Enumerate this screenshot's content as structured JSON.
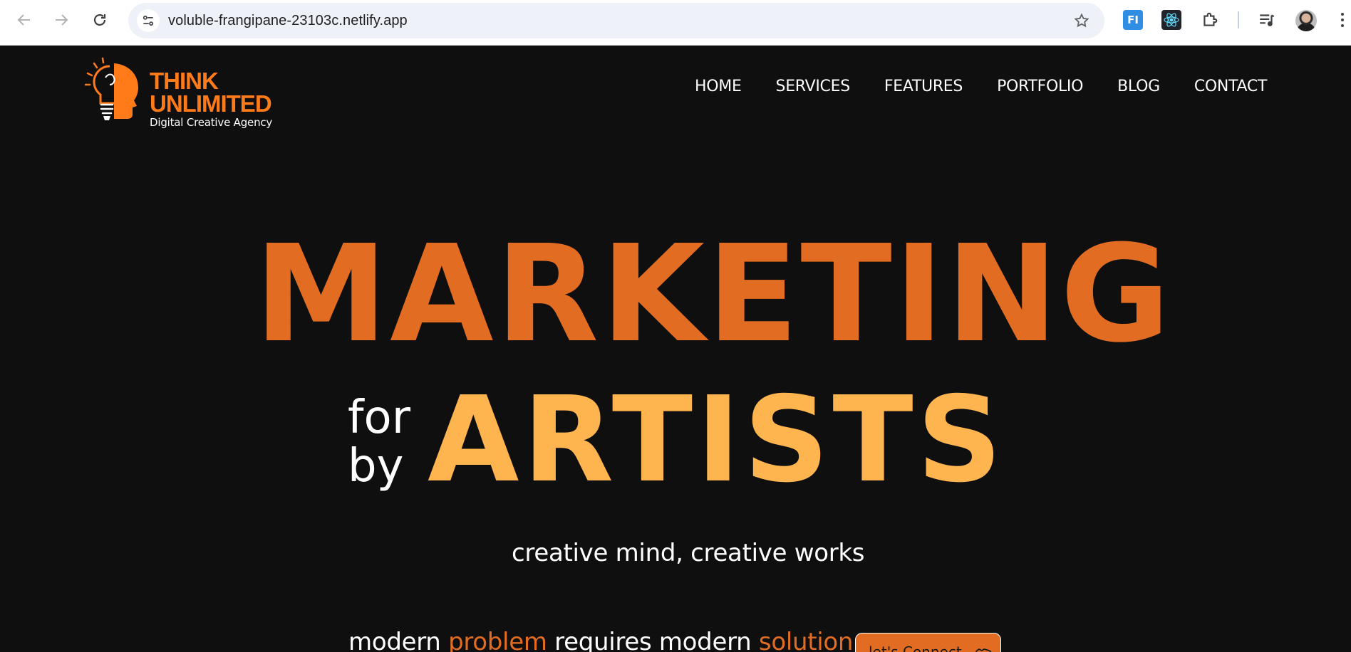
{
  "browser": {
    "url": "voluble-frangipane-23103c.netlify.app",
    "extensions": [
      {
        "name": "fi-extension-icon",
        "label": "FI"
      },
      {
        "name": "react-devtools-icon",
        "label": ""
      },
      {
        "name": "puzzle-icon",
        "label": ""
      },
      {
        "name": "media-controls-icon",
        "label": ""
      }
    ]
  },
  "brand": {
    "line1": "THINK",
    "line2": "UNLIMITED",
    "tagline": "Digital Creative Agency",
    "color": "#ff7b1a"
  },
  "nav": {
    "items": [
      "HOME",
      "SERVICES",
      "FEATURES",
      "PORTFOLIO",
      "BLOG",
      "CONTACT"
    ]
  },
  "hero": {
    "title": "MARKETING",
    "for": "for",
    "by": "by",
    "artists": "ARTISTS",
    "tagline": "creative mind, creative works",
    "problem_line": {
      "part1": "modern ",
      "highlight1": "problem",
      "part2": " requires modern ",
      "highlight2": "solution"
    },
    "cta_label": "let's Connect",
    "colors": {
      "primary": "#e26c22",
      "secondary": "#ffb54f",
      "background": "#0f0f0f"
    }
  }
}
